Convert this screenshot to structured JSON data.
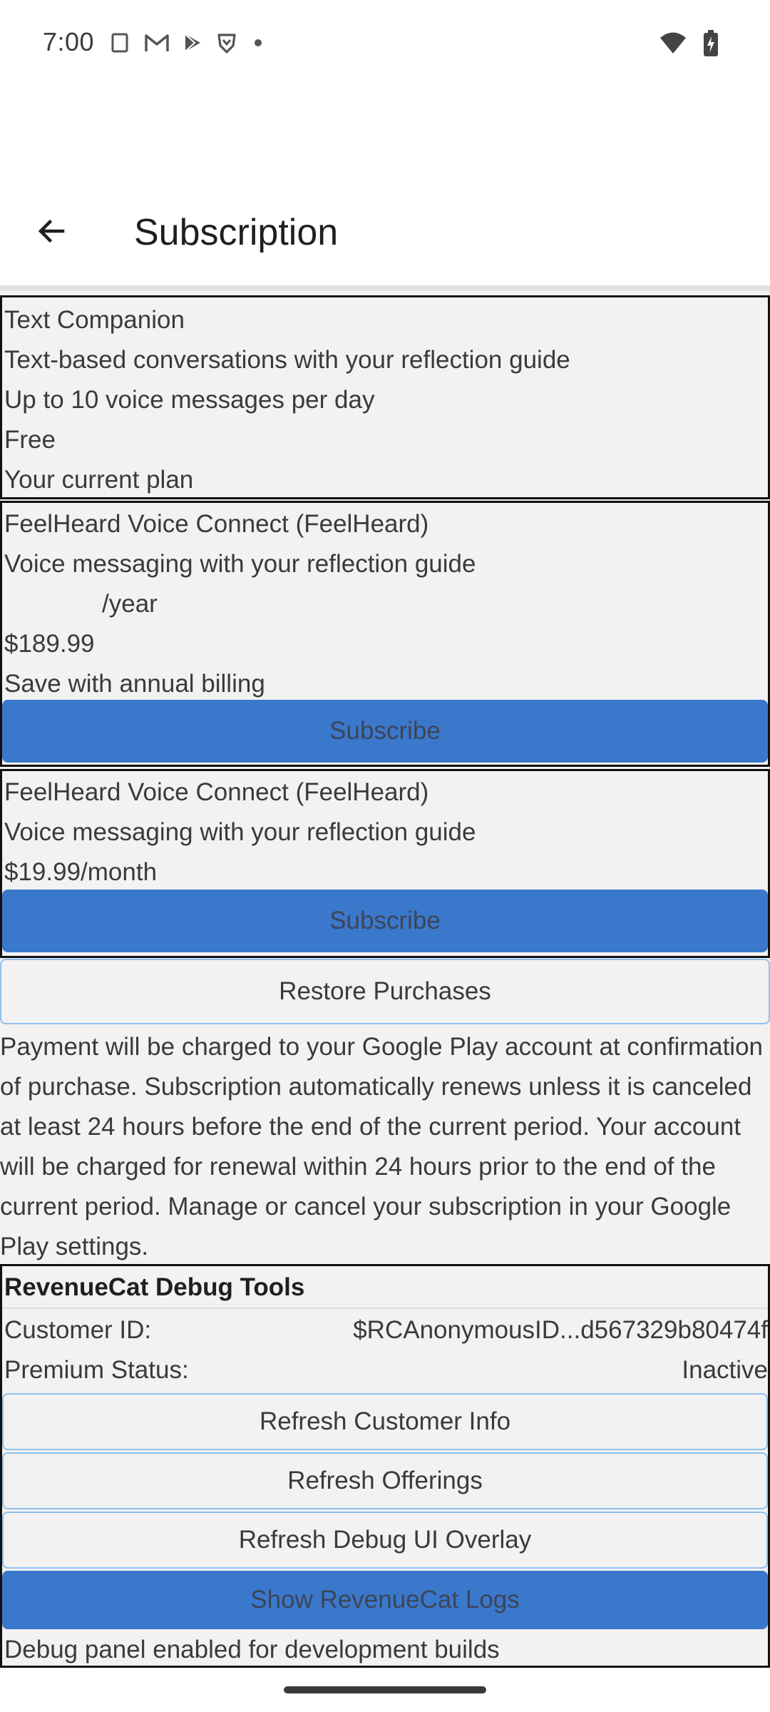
{
  "status_bar": {
    "time": "7:00",
    "left_icons": [
      "notification-icon",
      "gmail-icon",
      "play-store-icon",
      "brave-icon",
      "dot-icon"
    ],
    "right_icons": [
      "wifi-icon",
      "battery-charging-icon"
    ]
  },
  "app_bar": {
    "title": "Subscription",
    "back_icon": "arrow-back-icon"
  },
  "plans": [
    {
      "name": "Text Companion",
      "description": "Text-based conversations with your reflection guide",
      "detail": "Up to 10 voice messages per day",
      "price": "Free",
      "status": "Your current plan"
    },
    {
      "name": "FeelHeard Voice Connect (FeelHeard)",
      "description": "Voice messaging with your reflection guide",
      "period": "/year",
      "price": "$189.99",
      "note": "Save with annual billing",
      "button_label": "Subscribe"
    },
    {
      "name": "FeelHeard Voice Connect (FeelHeard)",
      "description": "Voice messaging with your reflection guide",
      "price": "$19.99/month",
      "button_label": "Subscribe"
    }
  ],
  "restore_label": "Restore Purchases",
  "legal_text": "Payment will be charged to your Google Play account at confirmation of purchase. Subscription automatically renews unless it is canceled at least 24 hours before the end of the current period. Your account will be charged for renewal within 24 hours prior to the end of the current period. Manage or cancel your subscription in your Google Play settings.",
  "debug": {
    "title": "RevenueCat Debug Tools",
    "customer_id_label": "Customer ID:",
    "customer_id_value": "$RCAnonymousID...d567329b80474f",
    "premium_status_label": "Premium Status:",
    "premium_status_value": "Inactive",
    "refresh_customer_label": "Refresh Customer Info",
    "refresh_offerings_label": "Refresh Offerings",
    "refresh_overlay_label": "Refresh Debug UI Overlay",
    "show_logs_label": "Show RevenueCat Logs",
    "footer_note": "Debug panel enabled for development builds"
  },
  "colors": {
    "primary_button": "#3a78cc",
    "outline_border": "#8fc1ee",
    "content_bg": "#f2f2f2"
  }
}
